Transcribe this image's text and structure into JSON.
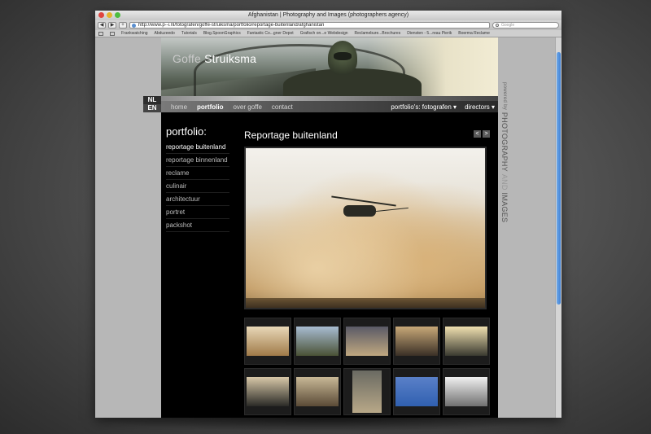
{
  "browser": {
    "title": "Afghanistan | Photography and Images (photographers agency)",
    "url": "http://www.p--i.nl/fotografen/goffe-struiksma/portfolio/reportage-buitenland/afghanistan",
    "search_placeholder": "Google",
    "bookmarks": [
      "Frankwatching",
      "Abduzeedo",
      "Tutorials",
      "Blog.SpoonGraphics",
      "Fantastic Co...gner Depot",
      "Grafisch on...e Webdesign",
      "Reclamebure...Brochures",
      "Diensten - 5...reau Pierik",
      "Boerma Reclame"
    ]
  },
  "site": {
    "brand_first": "Goffe",
    "brand_last": "Struiksma",
    "lang": [
      "NL",
      "EN"
    ],
    "nav": [
      "home",
      "portfolio",
      "over goffe",
      "contact"
    ],
    "nav_right": [
      "portfolio's: fotografen",
      "directors"
    ],
    "sidebar_title": "portfolio:",
    "sidebar_items": [
      "reportage buitenland",
      "reportage binnenland",
      "reclame",
      "culinair",
      "architectuur",
      "portret",
      "packshot"
    ],
    "main_title": "Reportage buitenland",
    "prev_icon": "<",
    "next_icon": ">",
    "right_powered": "powered by",
    "right_photography": "PHOTOGRAPHY",
    "right_and": "AND",
    "right_images": "IMAGES"
  },
  "thumb_colors": [
    [
      "#e8d8b8",
      "#a07a48"
    ],
    [
      "#a8bcd2",
      "#4a5236"
    ],
    [
      "#5a5a66",
      "#c0a880"
    ],
    [
      "#c8a878",
      "#3a3026"
    ],
    [
      "#f0e0b0",
      "#3a3a30"
    ],
    [
      "#d8c8a8",
      "#2a2a26"
    ],
    [
      "#c8b896",
      "#5a4a36"
    ],
    [
      "#6a6a62",
      "#b8a888"
    ],
    [
      "#5a80c8",
      "#3060b0"
    ],
    [
      "#f0f0f0",
      "#707070"
    ]
  ],
  "colors": {
    "nav_active": "#ffffff",
    "scroll_accent": "#3e7fd3"
  }
}
